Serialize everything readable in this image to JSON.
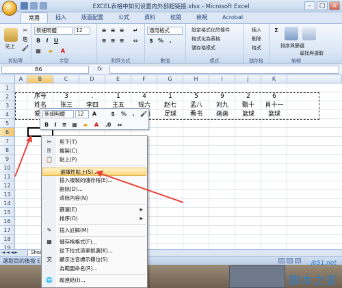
{
  "window": {
    "title": "EXCEL表格中如何设置内外部超链接.xlsx - Microsoft Excel",
    "controls": [
      "–",
      "□",
      "×"
    ]
  },
  "tabs": [
    "常用",
    "插入",
    "版面配置",
    "公式",
    "資料",
    "校閱",
    "檢視",
    "Acrobat"
  ],
  "ribbon": {
    "clipboard": {
      "label": "剪貼簿",
      "paste": "貼上"
    },
    "font": {
      "label": "字型",
      "name": "新細明體",
      "size": "12",
      "bold": "B",
      "italic": "I",
      "underline": "U",
      "font_color_letter": "A"
    },
    "alignment": {
      "label": "對齊方式"
    },
    "number": {
      "label": "數值",
      "format": "通用格式",
      "percent": "%",
      "comma": ","
    },
    "styles": {
      "label": "樣式",
      "conditional": "設定格式化的條件",
      "as_table": "格式化為表格",
      "cell_styles": "儲存格樣式"
    },
    "cells": {
      "label": "儲存格",
      "insert": "插入",
      "delete": "刪除",
      "format": "格式"
    },
    "editing": {
      "label": "編輯",
      "sum": "Σ",
      "sort": "排序與篩選",
      "find": "尋找與選取"
    }
  },
  "formula_bar": {
    "name_box": "B6",
    "fx": "fx",
    "formula": ""
  },
  "grid": {
    "columns": [
      "A",
      "B",
      "C",
      "D",
      "E",
      "F",
      "G",
      "H",
      "I",
      "J",
      "K"
    ],
    "rows": [
      "1",
      "2",
      "3",
      "4",
      "5",
      "6",
      "7",
      "8",
      "9",
      "10",
      "11",
      "12",
      "13",
      "14",
      "15",
      "16",
      "17",
      "18",
      "19"
    ],
    "table": {
      "row2": [
        "序号",
        "3",
        ".",
        "1",
        "4",
        "1",
        "5",
        "9",
        "2",
        "6"
      ],
      "row3": [
        "姓名",
        "张三",
        "李四",
        "王五",
        "钱六",
        "赵七",
        "孟八",
        "刘九",
        "甄十",
        "肖十一"
      ],
      "row4": [
        "爱好",
        "",
        "",
        "",
        "画画",
        "足球",
        "看书",
        "画画",
        "篮球",
        "篮球"
      ]
    }
  },
  "mini_toolbar": {
    "font": "新細明體",
    "size": "12",
    "bold": "B",
    "italic": "I",
    "percent": "%",
    "comma": ",",
    "font_color_letter": "A"
  },
  "context_menu": {
    "items": [
      {
        "label": "剪下(T)",
        "icon": "scissors-icon",
        "glyph": "✂"
      },
      {
        "label": "複製(C)",
        "icon": "copy-icon",
        "glyph": "⎘"
      },
      {
        "label": "貼上(P)",
        "icon": "paste-icon",
        "glyph": "📋"
      },
      {
        "label": "選擇性貼上(S)...",
        "icon": "",
        "glyph": ""
      },
      {
        "label": "插入複製的儲存格(E)...",
        "icon": "",
        "glyph": ""
      },
      {
        "label": "刪除(D)...",
        "icon": "",
        "glyph": ""
      },
      {
        "label": "清除內容(N)",
        "icon": "",
        "glyph": ""
      },
      {
        "label": "篩選(E)",
        "icon": "",
        "glyph": "",
        "submenu": true
      },
      {
        "label": "排序(O)",
        "icon": "",
        "glyph": "",
        "submenu": true
      },
      {
        "label": "插入註解(M)",
        "icon": "comment-icon",
        "glyph": "✎"
      },
      {
        "label": "儲存格格式(F)...",
        "icon": "format-cells-icon",
        "glyph": "▦"
      },
      {
        "label": "從下拉式清單挑選(K)...",
        "icon": "",
        "glyph": ""
      },
      {
        "label": "顯示注音標示欄位(S)",
        "icon": "phonetic-icon",
        "glyph": "文"
      },
      {
        "label": "為範圍命名(R)...",
        "icon": "",
        "glyph": ""
      },
      {
        "label": "超連結(I)...",
        "icon": "hyperlink-icon",
        "glyph": "🌐"
      }
    ]
  },
  "sheet_tab": "Sheet",
  "status_bar": {
    "text": "選取目的後按 Ent"
  },
  "watermark": {
    "site": "jb51.net",
    "name": "脚本之家"
  },
  "colors": {
    "ribbon": "#dbe7f5",
    "highlight": "#ffd57a",
    "arrow": "#e8443a"
  }
}
